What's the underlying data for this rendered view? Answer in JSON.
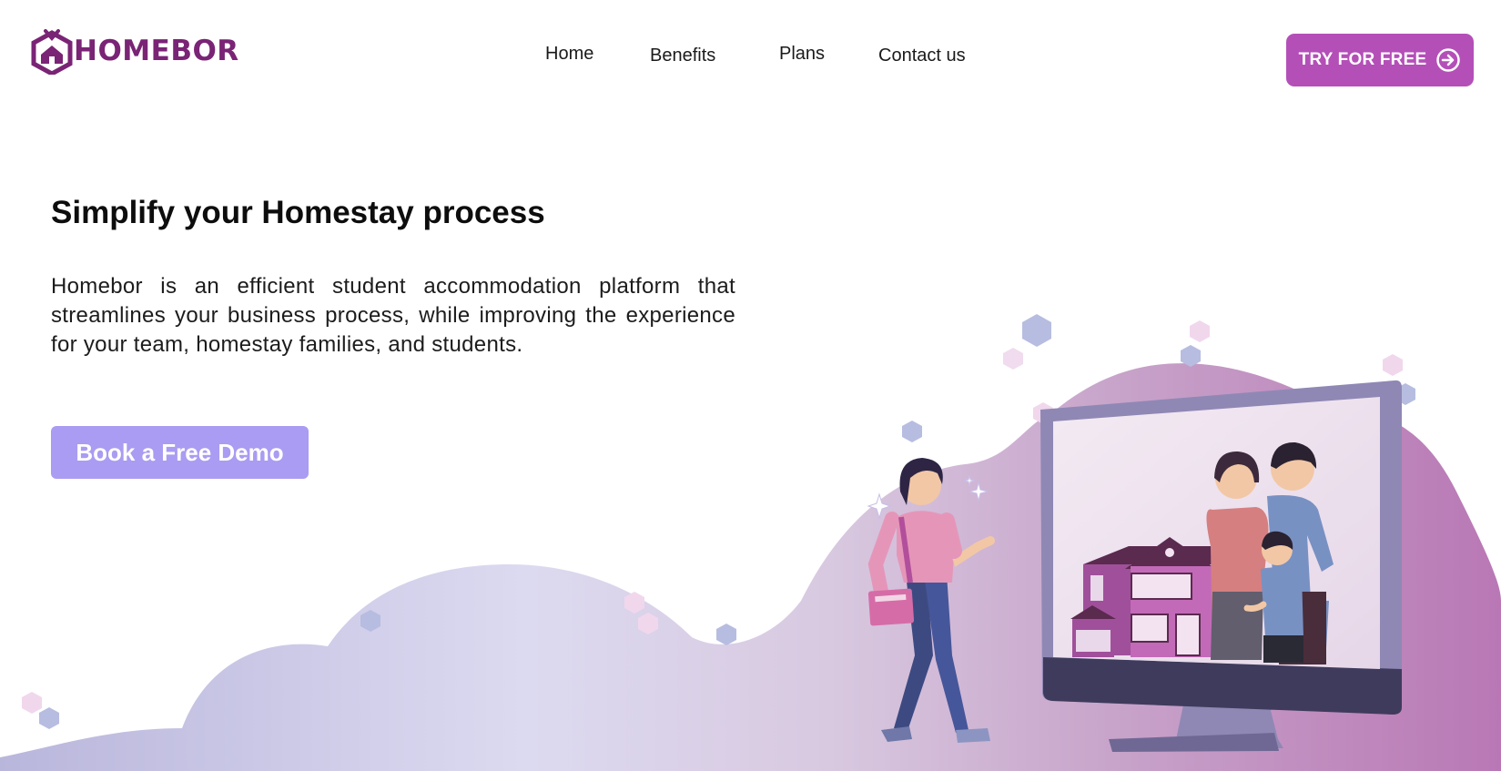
{
  "brand": {
    "name": "HOMEBOR",
    "color": "#7a2475"
  },
  "nav": {
    "items": [
      {
        "label": "Home"
      },
      {
        "label": "Benefits"
      },
      {
        "label": "Plans"
      },
      {
        "label": "Contact us"
      }
    ]
  },
  "header": {
    "cta_label": "TRY FOR FREE",
    "cta_icon": "arrow-right-circle-icon",
    "cta_color": "#b44fb8"
  },
  "hero": {
    "title": "Simplify your Homestay process",
    "description": "Homebor is an efficient student accommodation platform that streamlines your business process, while improving the experience for your team, homestay families, and students.",
    "demo_button_label": "Book a Free Demo",
    "demo_button_color": "#a99cf2"
  },
  "illustration": {
    "subjects": [
      "student-walking-illustration",
      "monitor-illustration",
      "family-illustration",
      "house-illustration",
      "hexagon-decoration-icon"
    ],
    "colors": {
      "blob_left": "#c9c6e6",
      "blob_right": "#c08fbf",
      "monitor_frame": "#8f88b5",
      "monitor_base": "#3f3b5c"
    }
  }
}
